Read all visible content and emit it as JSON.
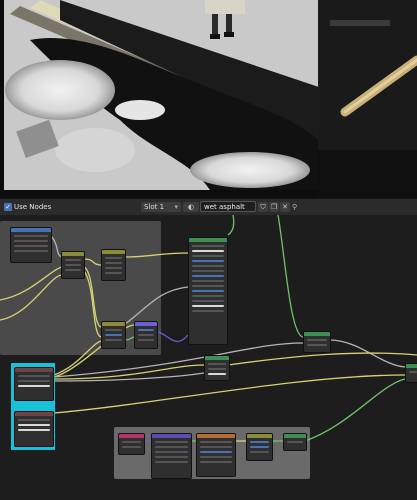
{
  "header": {
    "use_nodes_label": "Use Nodes",
    "use_nodes_checked": true,
    "slot": "Slot 1",
    "material_name": "wet asphalt",
    "icons": [
      "material-browse-icon",
      "fake-user-icon",
      "duplicate-icon",
      "close-icon",
      "pin-icon"
    ]
  },
  "colors": {
    "accent": "#4772b3",
    "selection": "#17c1d9",
    "link_yellow": "#d6d274",
    "link_green": "#6fc06b",
    "link_purple": "#6c5fd2",
    "link_gray": "#b5b5b5",
    "frame": "#666666"
  }
}
